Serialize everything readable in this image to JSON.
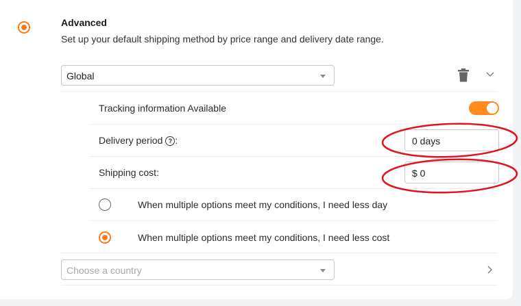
{
  "section": {
    "title": "Advanced",
    "subtitle": "Set up your default shipping method by price range and delivery date range."
  },
  "region_select": {
    "value": "Global"
  },
  "tracking": {
    "label": "Tracking information Available",
    "enabled": true
  },
  "delivery_period": {
    "label": "Delivery period",
    "suffix": ":",
    "value": "0 days"
  },
  "shipping_cost": {
    "label": "Shipping cost",
    "suffix": ":",
    "value": "$ 0"
  },
  "options": [
    {
      "label": "When multiple options meet my conditions, I need less day",
      "selected": false
    },
    {
      "label": "When multiple options meet my conditions, I need less cost",
      "selected": true
    }
  ],
  "country_select": {
    "placeholder": "Choose a country"
  },
  "colors": {
    "accent": "#ff7a12",
    "annotation": "#e0141e"
  },
  "icons": [
    "radio-selected-icon",
    "trash-icon",
    "chevron-down-icon",
    "help-circle-icon",
    "chevron-right-icon"
  ]
}
